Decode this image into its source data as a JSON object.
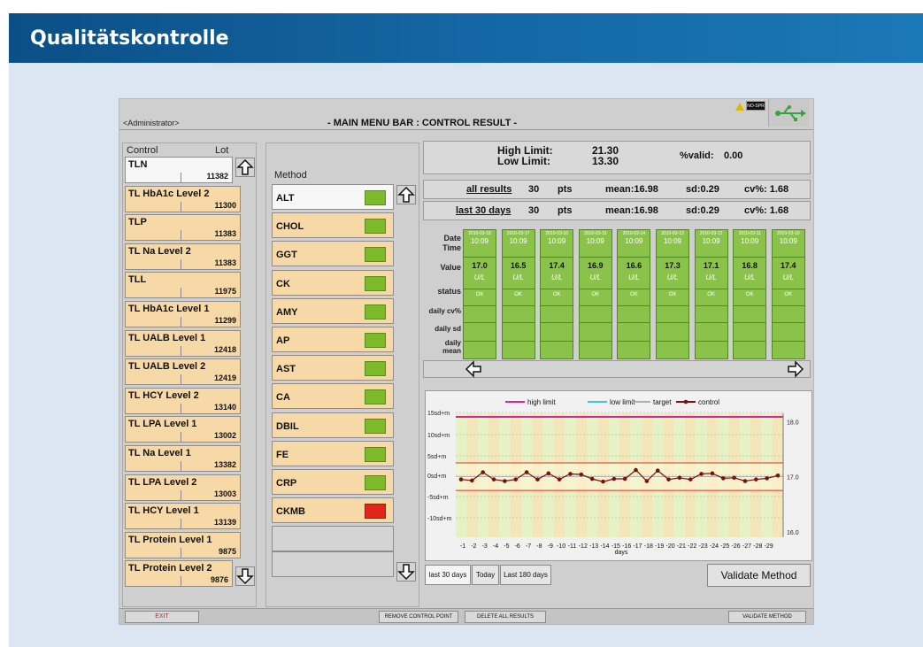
{
  "banner": {
    "title": "Qualitätskontrolle"
  },
  "header": {
    "user": "<Administrator>",
    "title": "- MAIN MENU BAR : CONTROL RESULT -",
    "warning_label": "NO-SPR"
  },
  "controls": {
    "col_control": "Control",
    "col_lot": "Lot",
    "items": [
      {
        "name": "TLN",
        "lot": "11382",
        "selected": true
      },
      {
        "name": "TL HbA1c Level 2",
        "lot": "11300"
      },
      {
        "name": "TLP",
        "lot": "11383"
      },
      {
        "name": "TL Na Level 2",
        "lot": "11383"
      },
      {
        "name": "TLL",
        "lot": "11975"
      },
      {
        "name": "TL HbA1c Level 1",
        "lot": "11299"
      },
      {
        "name": "TL UALB Level 1",
        "lot": "12418"
      },
      {
        "name": "TL UALB Level 2",
        "lot": "12419"
      },
      {
        "name": "TL HCY Level 2",
        "lot": "13140"
      },
      {
        "name": "TL LPA Level 1",
        "lot": "13002"
      },
      {
        "name": "TL Na Level 1",
        "lot": "13382"
      },
      {
        "name": "TL LPA Level 2",
        "lot": "13003"
      },
      {
        "name": "TL HCY Level 1",
        "lot": "13139"
      },
      {
        "name": "TL Protein Level 1",
        "lot": "9875"
      },
      {
        "name": "TL Protein Level 2",
        "lot": "9876"
      }
    ]
  },
  "methods": {
    "heading": "Method",
    "items": [
      {
        "name": "ALT",
        "status": "green",
        "selected": true
      },
      {
        "name": "CHOL",
        "status": "green"
      },
      {
        "name": "GGT",
        "status": "green"
      },
      {
        "name": "CK",
        "status": "green"
      },
      {
        "name": "AMY",
        "status": "green"
      },
      {
        "name": "AP",
        "status": "green"
      },
      {
        "name": "AST",
        "status": "green"
      },
      {
        "name": "CA",
        "status": "green"
      },
      {
        "name": "DBIL",
        "status": "green"
      },
      {
        "name": "FE",
        "status": "green"
      },
      {
        "name": "CRP",
        "status": "green"
      },
      {
        "name": "CKMB",
        "status": "red"
      }
    ]
  },
  "limits": {
    "high_label": "High Limit:",
    "high_value": "21.30",
    "low_label": "Low Limit:",
    "low_value": "13.30",
    "valid_label": "%valid:",
    "valid_value": "0.00"
  },
  "stats": [
    {
      "label": "all results",
      "count": "30",
      "unit": "pts",
      "mean": "mean:16.98",
      "sd": "sd:0.29",
      "cv": "cv%: 1.68"
    },
    {
      "label": "last 30 days",
      "count": "30",
      "unit": "pts",
      "mean": "mean:16.98",
      "sd": "sd:0.29",
      "cv": "cv%: 1.68"
    }
  ],
  "grid": {
    "row_labels": {
      "date": "Date",
      "time": "Time",
      "value": "Value",
      "status": "status",
      "cv": "daily cv%",
      "sd": "daily sd",
      "mean": "daily mean"
    },
    "columns": [
      {
        "date": "2010-03-18",
        "time": "10:09",
        "value": "17.0",
        "unit": "U/L",
        "status": "OK"
      },
      {
        "date": "2010-03-17",
        "time": "10:09",
        "value": "16.5",
        "unit": "U/L",
        "status": "OK"
      },
      {
        "date": "2010-03-16",
        "time": "10:09",
        "value": "17.4",
        "unit": "U/L",
        "status": "OK"
      },
      {
        "date": "2010-03-15",
        "time": "10:09",
        "value": "16.9",
        "unit": "U/L",
        "status": "OK"
      },
      {
        "date": "2010-03-14",
        "time": "10:09",
        "value": "16.6",
        "unit": "U/L",
        "status": "OK"
      },
      {
        "date": "2010-03-13",
        "time": "10:09",
        "value": "17.3",
        "unit": "U/L",
        "status": "OK"
      },
      {
        "date": "2010-03-12",
        "time": "10:09",
        "value": "17.1",
        "unit": "U/L",
        "status": "OK"
      },
      {
        "date": "2010-03-11",
        "time": "10:09",
        "value": "16.8",
        "unit": "U/L",
        "status": "OK"
      },
      {
        "date": "2010-03-10",
        "time": "10:09",
        "value": "17.4",
        "unit": "U/L",
        "status": "OK"
      }
    ]
  },
  "chart_data": {
    "type": "line",
    "legend": [
      "high limit",
      "low limit",
      "target",
      "control"
    ],
    "legend_placement": "top",
    "y_left_labels": [
      "15sd+m",
      "10sd+m",
      "5sd+m",
      "0sd+m",
      "-5sd+m",
      "-10sd+m"
    ],
    "y_right_labels": [
      "18.0",
      "17.0",
      "16.0"
    ],
    "x_ticks": [
      "-1",
      "-2",
      "-3",
      "-4",
      "-5",
      "-6",
      "-7",
      "-8",
      "-9",
      "-10",
      "-11",
      "-12",
      "-13",
      "-14",
      "-15",
      "-16",
      "-17",
      "-18",
      "-19",
      "-20",
      "-21",
      "-22",
      "-23",
      "-24",
      "-25",
      "-26",
      "-27",
      "-28",
      "-29"
    ],
    "xlabel": "days",
    "x": [
      -1,
      -2,
      -3,
      -4,
      -5,
      -6,
      -7,
      -8,
      -9,
      -10,
      -11,
      -12,
      -13,
      -14,
      -15,
      -16,
      -17,
      -18,
      -19,
      -20,
      -21,
      -22,
      -23,
      -24,
      -25,
      -26,
      -27,
      -28,
      -29,
      -30
    ],
    "control": [
      16.95,
      16.93,
      17.08,
      16.95,
      16.92,
      16.95,
      17.08,
      16.95,
      17.06,
      16.95,
      17.05,
      17.04,
      16.96,
      16.91,
      16.96,
      16.96,
      17.12,
      16.92,
      17.11,
      16.95,
      16.98,
      16.95,
      17.05,
      17.06,
      16.97,
      16.98,
      16.92,
      16.95,
      16.97,
      17.02
    ],
    "ylim": [
      15.9,
      18.15
    ],
    "colors": {
      "high_limit": "#d6239f",
      "low_limit": "#3ec7d8",
      "target": "#b0b0b0",
      "control": "#7a1010"
    }
  },
  "tabs": [
    {
      "label": "last 30 days",
      "selected": true
    },
    {
      "label": "Today"
    },
    {
      "label": "Last 180 days"
    }
  ],
  "validate_button": "Validate Method",
  "bottom_bar": {
    "exit": "EXIT",
    "remove": "REMOVE CONTROL POINT",
    "delete": "DELETE ALL RESULTS",
    "validate": "VALIDATE METHOD"
  }
}
